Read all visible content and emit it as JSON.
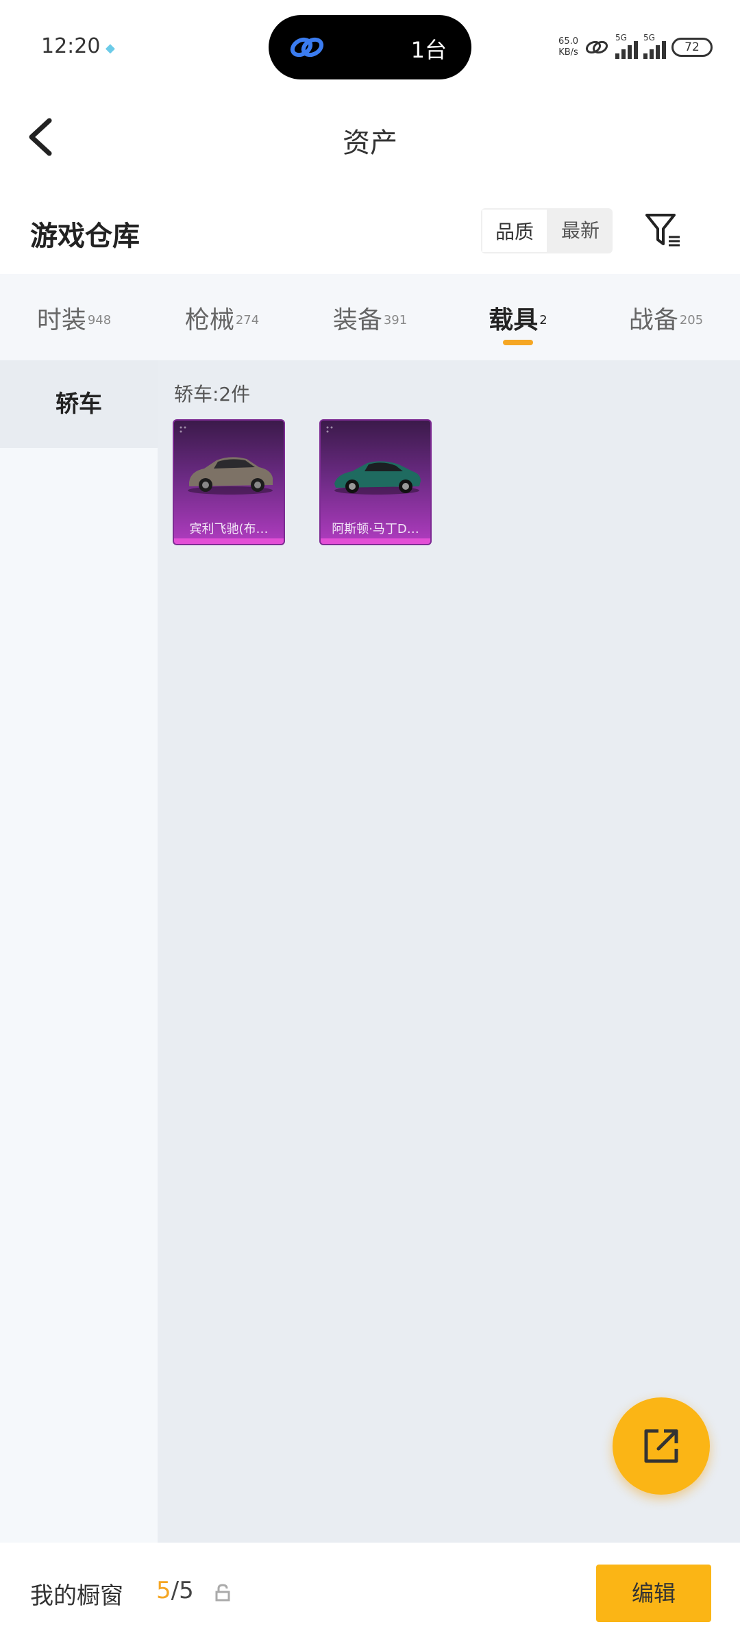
{
  "status_bar": {
    "time": "12:20",
    "island_text": "1台",
    "net_speed": "65.0",
    "net_unit": "KB/s",
    "sig1_label": "5G",
    "sig2_label": "5G",
    "battery": "72"
  },
  "header": {
    "title": "资产"
  },
  "section": {
    "title": "游戏仓库",
    "sort_options": [
      "品质",
      "最新"
    ],
    "active_sort": "品质"
  },
  "tabs": [
    {
      "label": "时装",
      "count": "948"
    },
    {
      "label": "枪械",
      "count": "274"
    },
    {
      "label": "装备",
      "count": "391"
    },
    {
      "label": "载具",
      "count": "2",
      "active": true
    },
    {
      "label": "战备",
      "count": "205"
    }
  ],
  "categories": [
    {
      "label": "轿车"
    }
  ],
  "content": {
    "count_label": "轿车:2件",
    "items": [
      {
        "name": "宾利飞驰(布…",
        "car_color": "#7d7266"
      },
      {
        "name": "阿斯顿·马丁D…",
        "car_color": "#1f6b60"
      }
    ]
  },
  "bottom_bar": {
    "label": "我的橱窗",
    "count_current": "5",
    "count_total": "/5",
    "edit_label": "编辑"
  },
  "colors": {
    "accent": "#fbb515",
    "tab_underline": "#f5a623",
    "card_gradient_top": "#3b1a4a",
    "card_gradient_bottom": "#b03cc0"
  }
}
